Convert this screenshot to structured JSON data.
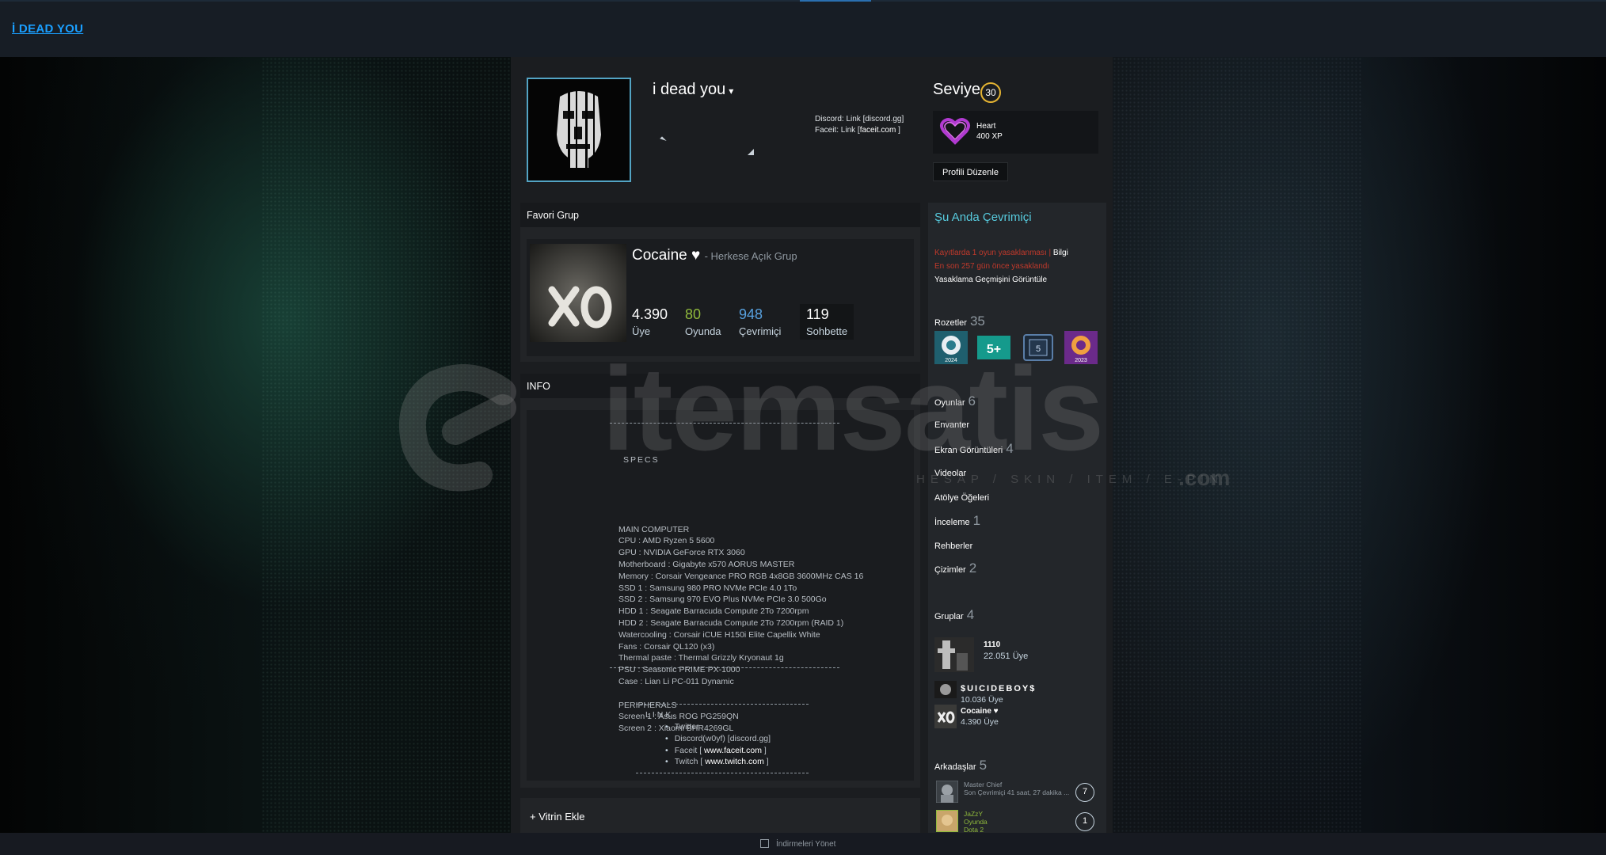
{
  "app": {
    "title": "İ DEAD YOU"
  },
  "profile": {
    "persona_name": "i dead you",
    "summary_line1": "Discord: Link [discord.gg]",
    "summary_line2_prefix": "Faceit: Link [",
    "summary_line2_link": "faceit.com",
    "summary_line2_suffix": "]",
    "level_label": "Seviye",
    "level": "30",
    "xp_badge_name": "Heart",
    "xp_badge_xp": "400 XP",
    "edit_button": "Profili Düzenle"
  },
  "favorite_group": {
    "header": "Favori Grup",
    "name": "Cocaine ♥",
    "type": "- Herkese Açık Grup",
    "stats": [
      {
        "value": "4.390",
        "label": "Üye",
        "color": "#ffffff"
      },
      {
        "value": "80",
        "label": "Oyunda",
        "color": "#90ba3c"
      },
      {
        "value": "948",
        "label": "Çevrimiçi",
        "color": "#57a0de"
      },
      {
        "value": "119",
        "label": "Sohbette",
        "color": "#ffffff"
      }
    ]
  },
  "info": {
    "header": "INFO",
    "specs_title": "SPECS",
    "spec_lines": [
      "MAIN COMPUTER",
      "CPU : AMD Ryzen 5 5600",
      "GPU : NVIDIA GeForce RTX 3060",
      "Motherboard : Gigabyte x570 AORUS MASTER",
      "Memory : Corsair Vengeance PRO RGB 4x8GB 3600MHz CAS 16",
      "SSD 1 : Samsung 980 PRO NVMe PCIe 4.0 1To",
      "SSD 2 : Samsung 970 EVO Plus NVMe PCIe 3.0 500Go",
      "HDD 1 : Seagate Barracuda Compute 2To 7200rpm",
      "HDD 2 : Seagate Barracuda Compute 2To 7200rpm (RAID 1)",
      "Watercooling : Corsair iCUE H150i Elite Capellix White",
      "Fans : Corsair QL120 (x3)",
      "Thermal paste : Thermal Grizzly Kryonaut 1g",
      "PSU : Seasonic PRIME PX-1000",
      "Case : Lian Li PC-011 Dynamic",
      "",
      "PERIPHERALS",
      "Screen 1 : Asus ROG PG259QN",
      "Screen 2 : Xiaomi BHR4269GL"
    ],
    "link_title": "LINK",
    "links": [
      {
        "pre": "Twitter",
        "link": "",
        "post": ""
      },
      {
        "pre": "Discord(w0yf) [discord.gg]",
        "link": "",
        "post": ""
      },
      {
        "pre": "Faceit [ ",
        "link": "www.faceit.com",
        "post": " ]"
      },
      {
        "pre": "Twitch [ ",
        "link": "www.twitch.com",
        "post": " ]"
      }
    ]
  },
  "showcase": {
    "add_label": "+ Vitrin Ekle"
  },
  "sidebar": {
    "status": "Şu Anda Çevrimiçi",
    "ban_text": "Kayıtlarda 1 oyun yasaklanması |",
    "ban_info_link": "Bilgi",
    "ban_days": "En son 257 gün önce yasaklandı",
    "ban_history": "Yasaklama Geçmişini Görüntüle",
    "badges_label": "Rozetler",
    "badges_count": "35",
    "badge_labels": [
      "2024",
      "5+",
      "5",
      "2023"
    ],
    "games_label": "Oyunlar",
    "games_count": "6",
    "inventory_label": "Envanter",
    "screenshots_label": "Ekran Görüntüleri",
    "screenshots_count": "4",
    "videos_label": "Videolar",
    "workshop_label": "Atölye Öğeleri",
    "reviews_label": "İnceleme",
    "reviews_count": "1",
    "guides_label": "Rehberler",
    "artwork_label": "Çizimler",
    "artwork_count": "2",
    "groups_label": "Gruplar",
    "groups_count": "4",
    "groups": [
      {
        "name": "1110",
        "members": "22.051 Üye"
      },
      {
        "name": "$UICIDEBOY$",
        "members": "10.036 Üye"
      },
      {
        "name": "Cocaine ♥",
        "members": "4.390 Üye"
      }
    ],
    "friends_label": "Arkadaşlar",
    "friends_count": "5",
    "friends": [
      {
        "name": "Master Chief",
        "status": "Son Çevrimiçi 41 saat, 27 dakika ...",
        "extra": "",
        "level": "7",
        "color": "#8f98a0"
      },
      {
        "name": "JaZzY",
        "status": "Oyunda",
        "extra": "Dota 2",
        "level": "1",
        "color": "#90ba3c"
      }
    ]
  },
  "watermark": {
    "brand": "itemsatis",
    "tagline": "HESAP / SKIN / ITEM / E-PIN",
    "suffix": ".com"
  },
  "bottombar": {
    "downloads": "İndirmeleri Yönet"
  }
}
